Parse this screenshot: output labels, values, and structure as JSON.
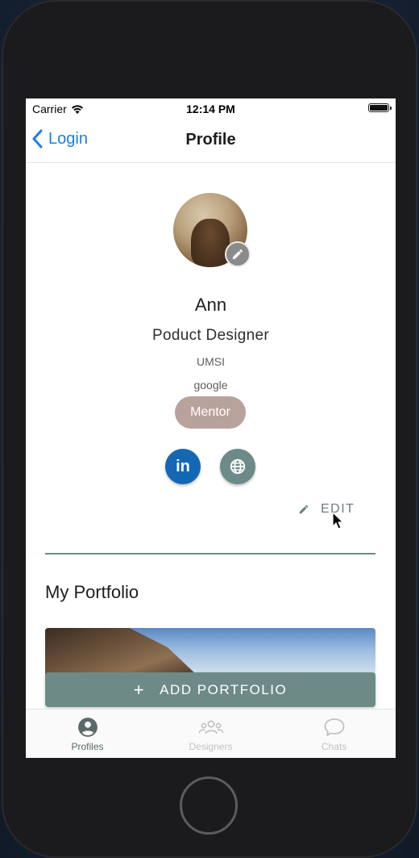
{
  "status_bar": {
    "carrier": "Carrier",
    "time": "12:14 PM"
  },
  "nav": {
    "back_label": "Login",
    "title": "Profile"
  },
  "profile": {
    "name": "Ann",
    "role": "Poduct Designer",
    "school": "UMSI",
    "company": "google",
    "badge": "Mentor",
    "edit_label": "EDIT"
  },
  "portfolio": {
    "section_title": "My Portfolio",
    "add_label": "ADD PORTFOLIO"
  },
  "tabs": [
    {
      "label": "Profiles",
      "icon": "account-circle-icon",
      "active": true
    },
    {
      "label": "Designers",
      "icon": "people-group-icon",
      "active": false
    },
    {
      "label": "Chats",
      "icon": "chat-bubble-icon",
      "active": false
    }
  ],
  "colors": {
    "accent_blue": "#1a7fe8",
    "primary_teal": "#6e8a87",
    "mentor_badge": "#b8a39c",
    "linkedin": "#1468b3"
  }
}
